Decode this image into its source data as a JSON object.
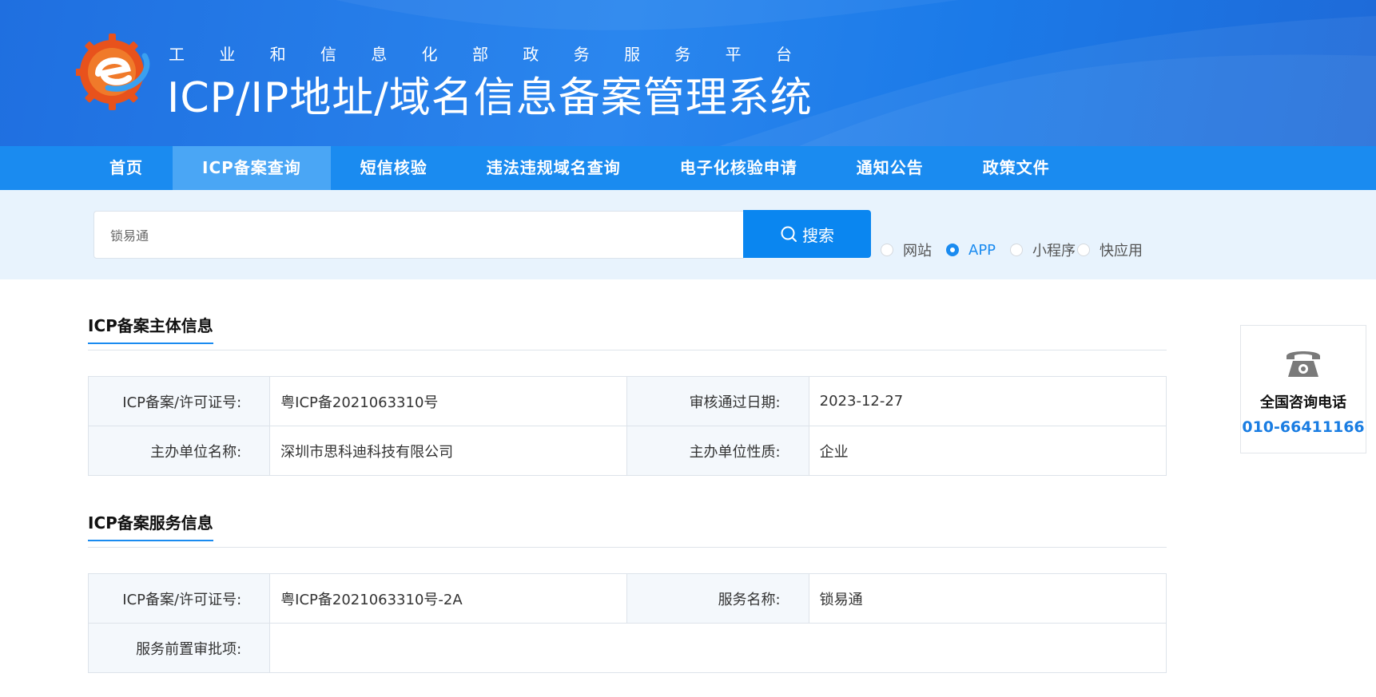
{
  "header": {
    "subtitle_chars": [
      "工",
      "业",
      "和",
      "信",
      "息",
      "化",
      "部",
      "政",
      "务",
      "服",
      "务",
      "平",
      "台"
    ],
    "title": "ICP/IP地址/域名信息备案管理系统"
  },
  "nav": {
    "items": [
      "首页",
      "ICP备案查询",
      "短信核验",
      "违法违规域名查询",
      "电子化核验申请",
      "通知公告",
      "政策文件"
    ],
    "active_index": 1
  },
  "search": {
    "value": "锁易通",
    "button_label": "搜索",
    "options": [
      {
        "label": "网站",
        "checked": false
      },
      {
        "label": "APP",
        "checked": true
      },
      {
        "label": "小程序",
        "checked": false
      },
      {
        "label": "快应用",
        "checked": false
      }
    ]
  },
  "subject": {
    "title": "ICP备案主体信息",
    "rows": [
      {
        "k1": "ICP备案/许可证号:",
        "v1": "粤ICP备2021063310号",
        "k2": "审核通过日期:",
        "v2": "2023-12-27"
      },
      {
        "k1": "主办单位名称:",
        "v1": "深圳市思科迪科技有限公司",
        "k2": "主办单位性质:",
        "v2": "企业"
      }
    ]
  },
  "service": {
    "title": "ICP备案服务信息",
    "row1": {
      "k1": "ICP备案/许可证号:",
      "v1": "粤ICP备2021063310号-2A",
      "k2": "服务名称:",
      "v2": "锁易通"
    },
    "row2": {
      "k1": "服务前置审批项:",
      "v1": ""
    }
  },
  "contact": {
    "label": "全国咨询电话",
    "phone": "010-66411166"
  },
  "colors": {
    "primary": "#1a8bf0",
    "nav_active": "#4aa6f5",
    "strip_bg": "#e8f3fd"
  }
}
